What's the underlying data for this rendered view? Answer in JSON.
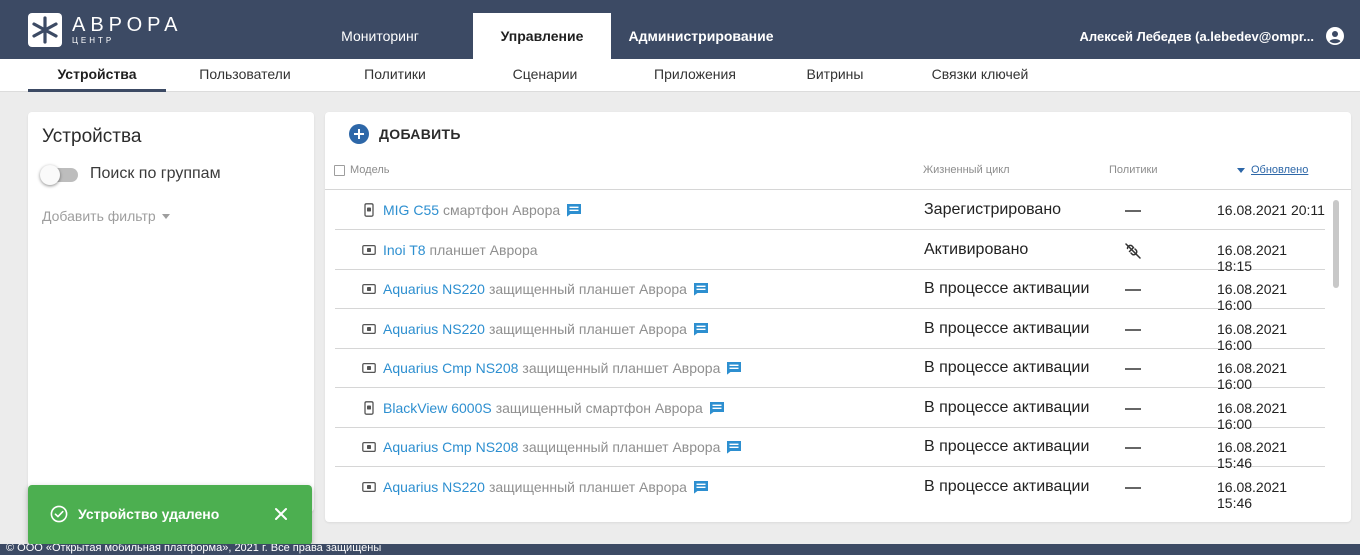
{
  "brand": {
    "title": "АВРОРА",
    "subtitle": "ЦЕНТР"
  },
  "main_tabs": [
    {
      "label": "Мониторинг"
    },
    {
      "label": "Управление"
    },
    {
      "label": "Администрирование"
    }
  ],
  "user": {
    "name": "Алексей Лебедев (a.lebedev@ompr..."
  },
  "sub_tabs": [
    {
      "label": "Устройства"
    },
    {
      "label": "Пользователи"
    },
    {
      "label": "Политики"
    },
    {
      "label": "Сценарии"
    },
    {
      "label": "Приложения"
    },
    {
      "label": "Витрины"
    },
    {
      "label": "Связки ключей"
    }
  ],
  "left_panel": {
    "title": "Устройства",
    "group_search_label": "Поиск по группам",
    "add_filter_label": "Добавить фильтр"
  },
  "toolbar": {
    "add_label": "ДОБАВИТЬ"
  },
  "table": {
    "headers": {
      "model": "Модель",
      "lifecycle": "Жизненный цикл",
      "policies": "Политики",
      "updated": "Обновлено"
    },
    "rows": [
      {
        "model": "MIG C55",
        "desc": "смартфон Аврора",
        "device": "phone",
        "chat": true,
        "lifecycle": "Зарегистрировано",
        "policy": "dash",
        "updated": "16.08.2021 20:11"
      },
      {
        "model": "Inoi T8",
        "desc": "планшет Аврора",
        "device": "tablet",
        "chat": false,
        "lifecycle": "Активировано",
        "policy": "unlink",
        "updated": "16.08.2021 18:15"
      },
      {
        "model": "Aquarius NS220",
        "desc": "защищенный планшет Аврора",
        "device": "tablet",
        "chat": true,
        "lifecycle": "В процессе активации",
        "policy": "dash",
        "updated": "16.08.2021 16:00"
      },
      {
        "model": "Aquarius NS220",
        "desc": "защищенный планшет Аврора",
        "device": "tablet",
        "chat": true,
        "lifecycle": "В процессе активации",
        "policy": "dash",
        "updated": "16.08.2021 16:00"
      },
      {
        "model": "Aquarius Cmp NS208",
        "desc": "защищенный планшет Аврора",
        "device": "tablet",
        "chat": true,
        "lifecycle": "В процессе активации",
        "policy": "dash",
        "updated": "16.08.2021 16:00"
      },
      {
        "model": "BlackView 6000S",
        "desc": "защищенный смартфон Аврора",
        "device": "phone",
        "chat": true,
        "lifecycle": "В процессе активации",
        "policy": "dash",
        "updated": "16.08.2021 16:00"
      },
      {
        "model": "Aquarius Cmp NS208",
        "desc": "защищенный планшет Аврора",
        "device": "tablet",
        "chat": true,
        "lifecycle": "В процессе активации",
        "policy": "dash",
        "updated": "16.08.2021 15:46"
      },
      {
        "model": "Aquarius NS220",
        "desc": "защищенный планшет Аврора",
        "device": "tablet",
        "chat": true,
        "lifecycle": "В процессе активации",
        "policy": "dash",
        "updated": "16.08.2021 15:46"
      }
    ]
  },
  "toast": {
    "message": "Устройство удалено"
  },
  "footer": {
    "text": "© ООО «Открытая мобильная платформа», 2021 г. Все права защищены"
  },
  "colors": {
    "header_bg": "#3c4a64",
    "accent": "#2d67a8",
    "link": "#2d8fd0",
    "toast_bg": "#4caf50"
  }
}
